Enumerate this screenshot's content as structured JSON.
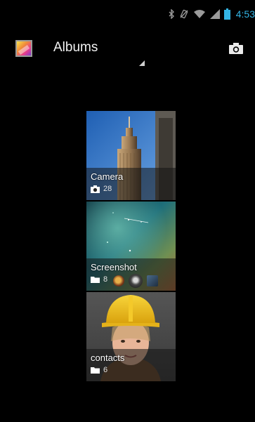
{
  "status_bar": {
    "time": "4:53",
    "icons": [
      "bluetooth-icon",
      "vibrate-muted-icon",
      "wifi-icon",
      "cell-signal-icon",
      "battery-icon"
    ]
  },
  "action_bar": {
    "title": "Albums",
    "camera_icon": "camera-icon"
  },
  "albums": [
    {
      "name": "Camera",
      "type_icon": "camera-icon",
      "count": "28"
    },
    {
      "name": "Screenshot",
      "type_icon": "folder-icon",
      "count": "8"
    },
    {
      "name": "contacts",
      "type_icon": "folder-icon",
      "count": "6"
    }
  ],
  "colors": {
    "accent": "#33b5e5",
    "background": "#000000"
  }
}
